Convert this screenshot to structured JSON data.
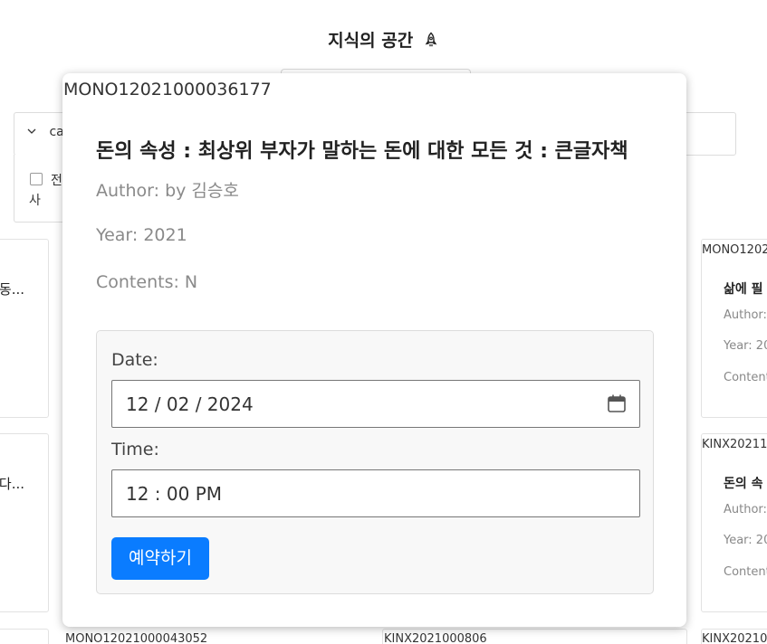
{
  "page": {
    "title": "지식의 공간",
    "title_icon": "rocket-icon"
  },
  "filter": {
    "toggle_label": "ca",
    "option_all": "전",
    "option_wrap": "사"
  },
  "background_cards": [
    {
      "snippet": "동..."
    },
    {
      "snippet": "다..."
    },
    {
      "code": "MONO12021000043052"
    },
    {
      "code": "KINX2021000806"
    },
    {
      "code": "MONO1202",
      "title": "삶에 필",
      "author": "Author:",
      "year": "Year: 20",
      "contents": "Content"
    },
    {
      "code": "KINX20211",
      "title": "돈의 속",
      "author": "Author:",
      "year": "Year: 20",
      "contents": "Content"
    },
    {
      "code": "KINX20210"
    }
  ],
  "modal": {
    "code": "MONO12021000036177",
    "title": "돈의 속성 : 최상위 부자가 말하는 돈에 대한 모든 것 : 큰글자책",
    "author": "Author: by 김승호",
    "year": "Year: 2021",
    "contents": "Contents: N",
    "date_label": "Date:",
    "date_value": "12 / 02 / 2024",
    "time_label": "Time:",
    "time_value": "12 : 00   PM",
    "reserve_button": "예약하기"
  },
  "colors": {
    "accent": "#0a7cff",
    "meta_text": "#8a8a8a"
  }
}
